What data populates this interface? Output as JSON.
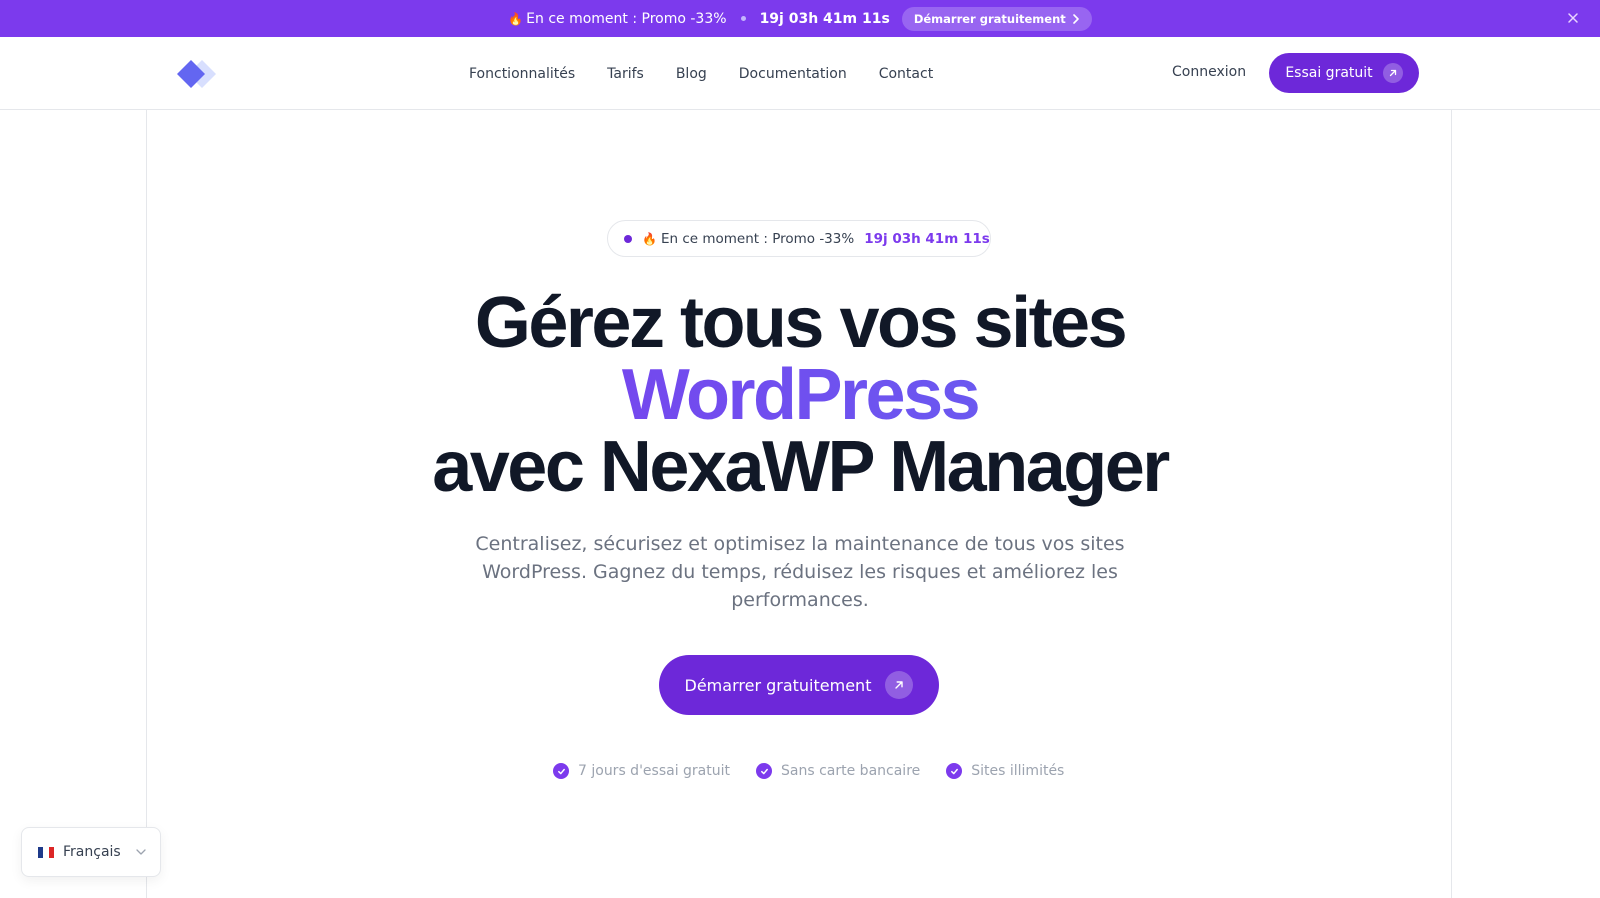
{
  "promo_bar": {
    "emoji": "🔥",
    "text": "En ce moment : Promo -33%",
    "timer": "19j 03h 41m 11s",
    "cta_label": "Démarrer gratuitement"
  },
  "header": {
    "nav": [
      "Fonctionnalités",
      "Tarifs",
      "Blog",
      "Documentation",
      "Contact"
    ],
    "login_label": "Connexion",
    "trial_label": "Essai gratuit"
  },
  "hero": {
    "pill": {
      "emoji": "🔥",
      "text": "En ce moment : Promo -33%",
      "timer": "19j 03h 41m 11s"
    },
    "headline_line1": "Gérez tous vos sites",
    "headline_accent": "WordPress",
    "headline_line3": "avec NexaWP Manager",
    "subtitle": "Centralisez, sécurisez et optimisez la maintenance de tous vos sites WordPress. Gagnez du temps, réduisez les risques et améliorez les performances.",
    "cta_label": "Démarrer gratuitement",
    "features": [
      "7 jours d'essai gratuit",
      "Sans carte bancaire",
      "Sites illimités"
    ]
  },
  "language": {
    "label": "Français"
  },
  "colors": {
    "primary": "#6d28d9",
    "promo_bg": "#7c3aed",
    "text_dark": "#111827",
    "text_muted": "#6b7280"
  }
}
